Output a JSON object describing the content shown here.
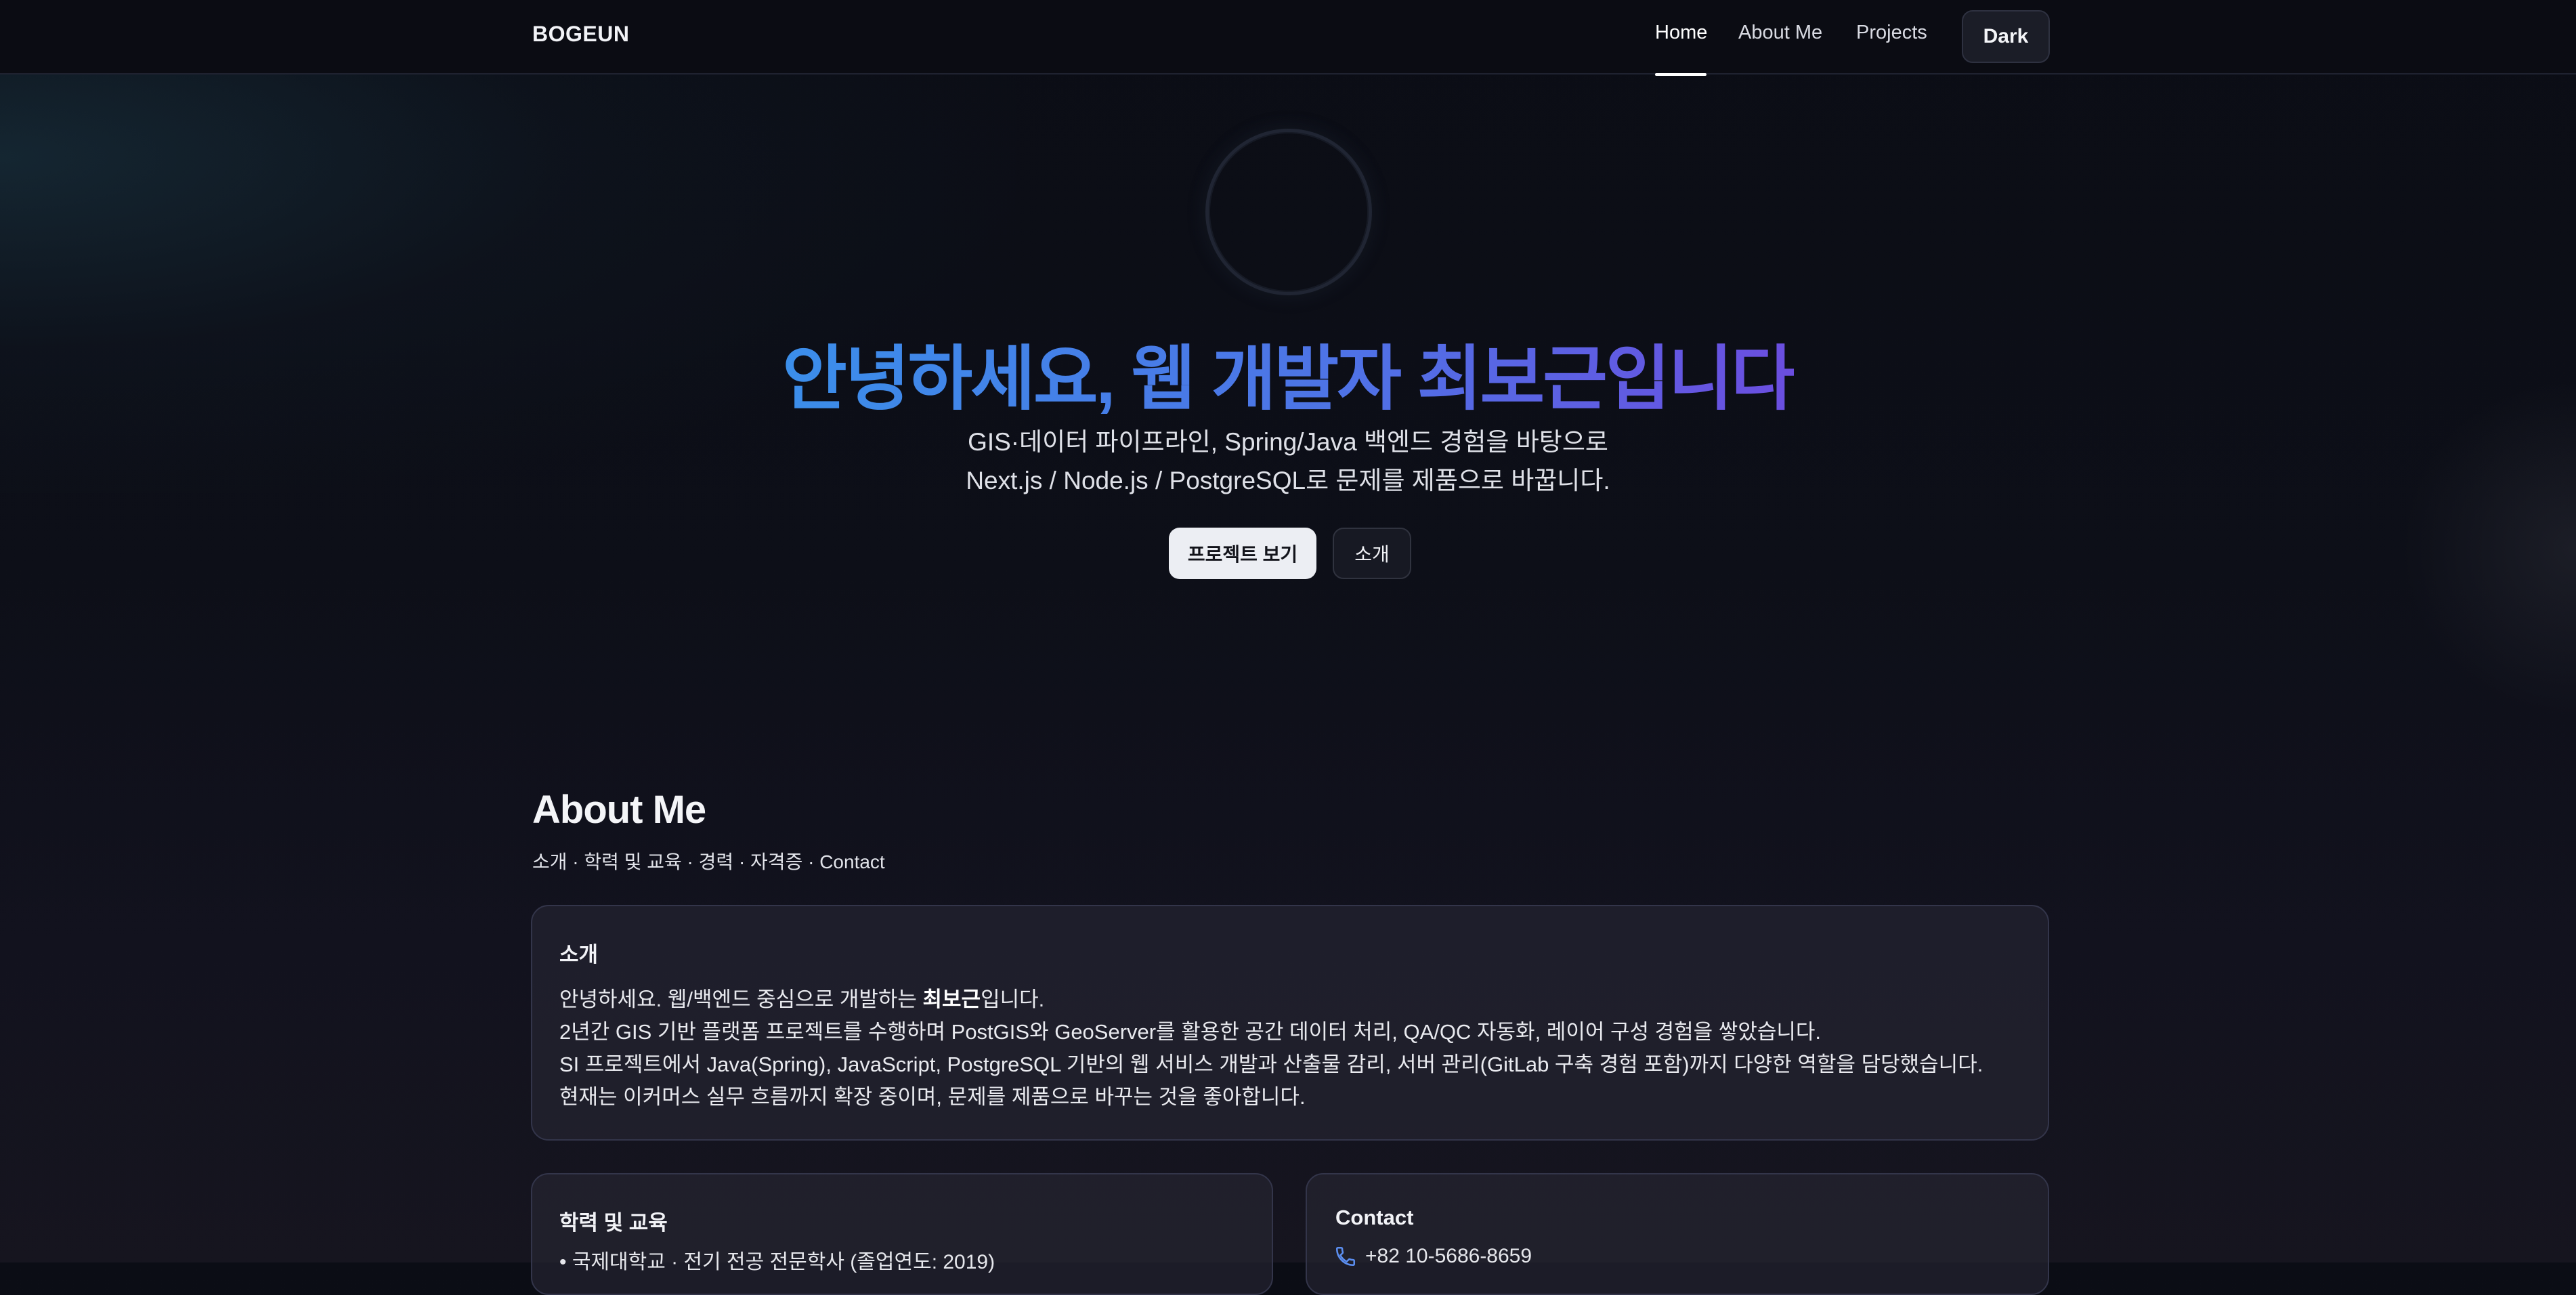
{
  "header": {
    "brand": "BOGEUN",
    "nav": [
      {
        "label": "Home",
        "active": true
      },
      {
        "label": "About Me",
        "active": false
      },
      {
        "label": "Projects",
        "active": false
      }
    ],
    "mode_button": "Dark"
  },
  "hero": {
    "title": "안녕하세요, 웹 개발자 최보근입니다",
    "subtitle_line1": "GIS·데이터 파이프라인, Spring/Java 백엔드 경험을 바탕으로",
    "subtitle_line2": "Next.js / Node.js / PostgreSQL로 문제를 제품으로 바꿉니다.",
    "primary_button": "프로젝트 보기",
    "secondary_button": "소개"
  },
  "about": {
    "title": "About Me",
    "subtitle": "소개 · 학력 및 교육 · 경력 · 자격증 · Contact",
    "intro": {
      "title": "소개",
      "line1_prefix": "안녕하세요. 웹/백엔드 중심으로 개발하는 ",
      "line1_name": "최보근",
      "line1_suffix": "입니다.",
      "line2": "2년간 GIS 기반 플랫폼 프로젝트를 수행하며 PostGIS와 GeoServer를 활용한 공간 데이터 처리, QA/QC 자동화, 레이어 구성 경험을 쌓았습니다.",
      "line3": "SI 프로젝트에서 Java(Spring), JavaScript, PostgreSQL 기반의 웹 서비스 개발과 산출물 감리, 서버 관리(GitLab 구축 경험 포함)까지 다양한 역할을 담당했습니다.",
      "line4": "현재는 이커머스 실무 흐름까지 확장 중이며, 문제를 제품으로 바꾸는 것을 좋아합니다."
    },
    "education": {
      "title": "학력 및 교육",
      "item1": "• 국제대학교 · 전기 전공 전문학사 (졸업연도: 2019)"
    },
    "contact": {
      "title": "Contact",
      "phone_icon": "phone-icon",
      "phone": "+82 10-5686-8659"
    }
  }
}
